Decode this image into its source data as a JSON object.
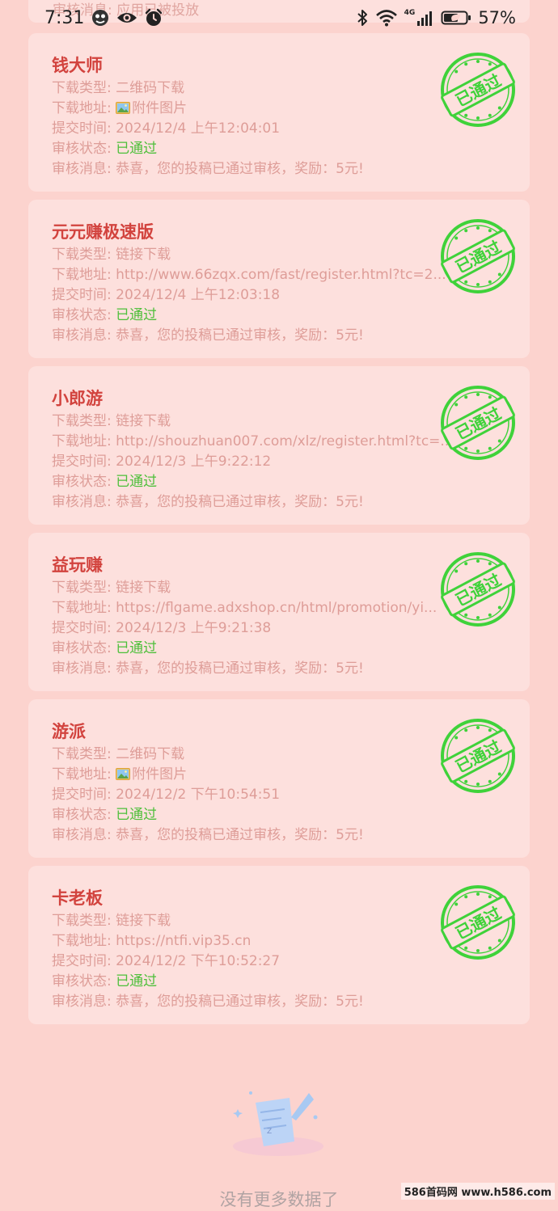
{
  "status_bar": {
    "time": "7:31",
    "network": "4G",
    "battery_pct": "57%"
  },
  "partial_row": {
    "text": "审核消息: 应用已被投放"
  },
  "labels": {
    "download_type": "下载类型: ",
    "download_url": "下载地址: ",
    "submit_time": "提交时间: ",
    "review_status": "审核状态: ",
    "review_msg": "审核消息: "
  },
  "stamp_text": "已通过",
  "records": [
    {
      "title": "钱大师",
      "type": "二维码下载",
      "url": "附件图片",
      "url_is_attachment": true,
      "time": "2024/12/4 上午12:04:01",
      "status": "已通过",
      "message": "恭喜，您的投稿已通过审核，奖励：5元!"
    },
    {
      "title": "元元赚极速版",
      "type": "链接下载",
      "url": "http://www.66zqx.com/fast/register.html?tc=2...",
      "url_is_attachment": false,
      "time": "2024/12/4 上午12:03:18",
      "status": "已通过",
      "message": "恭喜，您的投稿已通过审核，奖励：5元!"
    },
    {
      "title": "小郎游",
      "type": "链接下载",
      "url": "http://shouzhuan007.com/xlz/register.html?tc=...",
      "url_is_attachment": false,
      "time": "2024/12/3 上午9:22:12",
      "status": "已通过",
      "message": "恭喜，您的投稿已通过审核，奖励：5元!"
    },
    {
      "title": "益玩赚",
      "type": "链接下载",
      "url": "https://flgame.adxshop.cn/html/promotion/yi...",
      "url_is_attachment": false,
      "time": "2024/12/3 上午9:21:38",
      "status": "已通过",
      "message": "恭喜，您的投稿已通过审核，奖励：5元!"
    },
    {
      "title": "游派",
      "type": "二维码下载",
      "url": "附件图片",
      "url_is_attachment": true,
      "time": "2024/12/2 下午10:54:51",
      "status": "已通过",
      "message": "恭喜，您的投稿已通过审核，奖励：5元!"
    },
    {
      "title": "卡老板",
      "type": "链接下载",
      "url": "https://ntfi.vip35.cn",
      "url_is_attachment": false,
      "time": "2024/12/2 下午10:52:27",
      "status": "已通过",
      "message": "恭喜，您的投稿已通过审核，奖励：5元!"
    }
  ],
  "empty_state": {
    "text": "没有更多数据了"
  },
  "watermark": "586首码网 www.h586.com",
  "colors": {
    "background": "#fcd3ce",
    "card": "#fde0dd",
    "title": "#d2433e",
    "text": "#de9d98",
    "approved": "#4dbf3a",
    "stamp": "#3fd23a"
  }
}
